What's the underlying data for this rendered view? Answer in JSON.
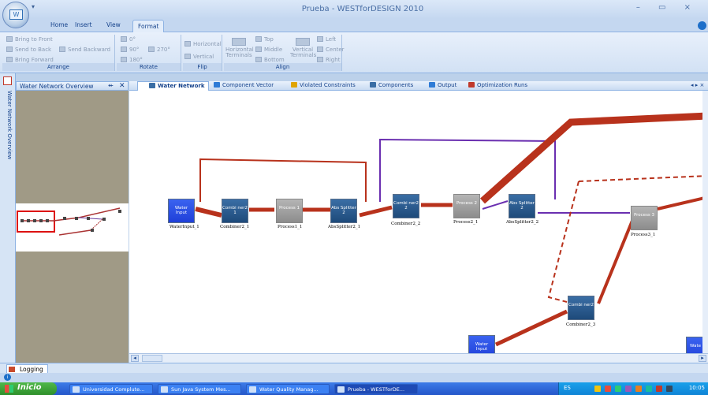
{
  "window": {
    "title": "Prueba - WESTforDESIGN 2010",
    "controls": "– ▭ ×"
  },
  "ribbon_tabs": [
    "Home",
    "Insert",
    "View",
    "Format"
  ],
  "ribbon": {
    "arrange": {
      "label": "Arrange",
      "bring_to_front": "Bring to Front",
      "send_to_back": "Send to Back",
      "send_backward": "Send Backward",
      "bring_forward": "Bring Forward"
    },
    "rotate": {
      "label": "Rotate",
      "r0": "0°",
      "r90": "90°",
      "r270": "270°",
      "r180": "180°"
    },
    "flip": {
      "label": "Flip",
      "horizontal": "Horizontal",
      "vertical": "Vertical"
    },
    "align": {
      "label": "Align",
      "horizontal_terminals": "Horizontal Terminals",
      "top": "Top",
      "middle": "Middle",
      "bottom": "Bottom",
      "vertical_terminals": "Vertical Terminals",
      "left": "Left",
      "center": "Center",
      "right": "Right"
    }
  },
  "side_strip": {
    "label": "Water Network Overview"
  },
  "overview_pane": {
    "title": "Water Network Overview",
    "pin": "⇷",
    "close": "✕"
  },
  "doc_tabs": [
    {
      "label": "Water Network",
      "icon": "network-icon",
      "color": "#3a6ea5"
    },
    {
      "label": "Component Vector",
      "icon": "vector-icon",
      "color": "#2e7bd6"
    },
    {
      "label": "Violated Constraints",
      "icon": "warning-icon",
      "color": "#e0a400"
    },
    {
      "label": "Components",
      "icon": "components-icon",
      "color": "#3a6ea5"
    },
    {
      "label": "Output",
      "icon": "output-icon",
      "color": "#2e7bd6"
    },
    {
      "label": "Optimization Runs",
      "icon": "runs-icon",
      "color": "#c0392b"
    }
  ],
  "tab_nav": "◂ ▸ ×",
  "nodes": [
    {
      "id": "WaterInput_1",
      "text": "Water Input",
      "label": "WaterInput_1",
      "style": "blue"
    },
    {
      "id": "Combiner2_1",
      "text": "Combi ner2 1",
      "label": "Combiner2_1",
      "style": "navy"
    },
    {
      "id": "Process1_1",
      "text": "Process 1",
      "label": "Process1_1",
      "style": "gray"
    },
    {
      "id": "AbsSplitter2_1",
      "text": "Abs Splitter 2",
      "label": "AbsSplitter2_1",
      "style": "navy"
    },
    {
      "id": "Combiner2_2",
      "text": "Combi ner2 2",
      "label": "Combiner2_2",
      "style": "navy"
    },
    {
      "id": "Process2_1",
      "text": "Process 2",
      "label": "Process2_1",
      "style": "gray"
    },
    {
      "id": "AbsSplitter2_2",
      "text": "Abs Splitter 2",
      "label": "AbsSplitter2_2",
      "style": "navy"
    },
    {
      "id": "Process3_1",
      "text": "Process 3",
      "label": "Process3_1",
      "style": "gray"
    },
    {
      "id": "Combiner2_3",
      "text": "Combi ner2",
      "label": "Combiner2_3",
      "style": "navy"
    },
    {
      "id": "WaterInput_2",
      "text": "Water Input",
      "label": "",
      "style": "blue"
    },
    {
      "id": "WaterInput_3",
      "text": "Wate",
      "label": "",
      "style": "blue"
    }
  ],
  "log_tab": "Logging",
  "taskbar": {
    "start": "Inicio",
    "items": [
      "Universidad Complute...",
      "Sun Java System Mes...",
      "Water Quality Manag...",
      "Prueba - WESTforDE..."
    ],
    "lang": "ES",
    "clock": "10:05"
  }
}
